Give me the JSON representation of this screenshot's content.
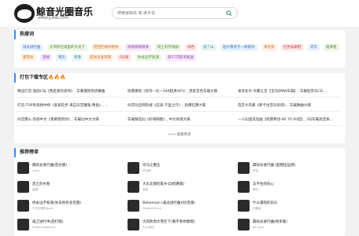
{
  "header": {
    "logo_text": "鲸音光圈音乐",
    "logo_url": "www.jywav.com",
    "search_placeholder": "搜索歌曲名 或 歌手名"
  },
  "hot_search": {
    "title": "热搜词",
    "tags": [
      {
        "label": "诚龙进行曲",
        "color": "c1"
      },
      {
        "label": "大风吹在城里的大号下",
        "color": "c2"
      },
      {
        "label": "把回忆拼好给你",
        "color": "c3"
      },
      {
        "label": "佩佩佩佩佩佩",
        "color": "c4"
      },
      {
        "label": "周土的芥纸帆",
        "color": "c2"
      },
      {
        "label": "绿色",
        "color": "c5"
      },
      {
        "label": "逃了山",
        "color": "c6"
      },
      {
        "label": "轻纱像弟子一样爱你",
        "color": "c1"
      },
      {
        "label": "青花瓷",
        "color": "c3"
      },
      {
        "label": "红色高跟鞋",
        "color": "c5"
      },
      {
        "label": "其实",
        "color": "c1"
      },
      {
        "label": "孤勇者",
        "color": "c2"
      },
      {
        "label": "蜜雪冰",
        "color": "c3"
      },
      {
        "label": "遗憾",
        "color": "c4"
      },
      {
        "label": "晴天",
        "color": "c1"
      },
      {
        "label": "草香",
        "color": "c6"
      },
      {
        "label": "是你没发现我",
        "color": "c3"
      },
      {
        "label": "QQ爱",
        "color": "c5"
      },
      {
        "label": "你永远不知道",
        "color": "c2"
      },
      {
        "label": "第57次取消发送",
        "color": "c4"
      }
    ]
  },
  "pack": {
    "title": "打包下载专区🔥🔥🔥",
    "rows": [
      [
        "精品打造-强劲CDJ《我是真的爱你》, 车载慢摇串烧舞曲",
        "经典重唱《等符一比一24K超清HiFi》, 黑胶音色车载大碟",
        "发烧女声-天籁之音【宝马BMW车载】, 车载轻音乐CD..."
      ],
      [
        "打造-TOP串烧榜中榜《爱爱轮步-来自天堂魔鬼-像鱼》, ...",
        "抖音DJ全网热搜《狂浪-千里之行》, 劲爆狂爆大碟",
        "电音大风暴《那卡拉音乐串烧》, 车载舞曲大碟"
      ],
      [
        "抖音爆火-伤感中文《我要我到你》, 车载DJ中文大碟",
        "车载精选DJ《好嗨嗨歌》, 中文串烧大碟",
        "一人DJ混成名曲【经典粤语-80 70 60后】, SQ车载高音质..."
      ]
    ],
    "more": ">>>查看更多"
  },
  "recommend": {
    "title": "推荐榜单",
    "songs": [
      {
        "title": "典狱长进行曲(后达版)",
        "artist": "Lime"
      },
      {
        "title": "司马之重庄",
        "artist": "司马南"
      },
      {
        "title": "典狱长进行曲 (超燃压迫感)",
        "artist": "佚名"
      },
      {
        "title": "黑土的乡愁",
        "artist": "高峰"
      },
      {
        "title": "大东北我的家乡(DJ何鹏版)",
        "artist": "高彤"
      },
      {
        "title": "冻不住的伤心",
        "artist": "陶钰"
      },
      {
        "title": "你永远不知道(失去你有多荒唐)",
        "artist": "千古刘德凯/John"
      },
      {
        "title": "Bohemian (威龙进行曲)(抖音版)",
        "artist": "Distant(Hunt)"
      },
      {
        "title": "什么雷暗的白头",
        "artist": "刘紫熠"
      },
      {
        "title": "威卫进行中(后打版)",
        "artist": "ProBlumedMusic"
      },
      {
        "title": "大风吹到大雪在下(看不到你嗯嗯)",
        "artist": "PGL/凝古"
      },
      {
        "title": "典狱长进行曲(纯享版)",
        "artist": "all voice"
      }
    ]
  }
}
